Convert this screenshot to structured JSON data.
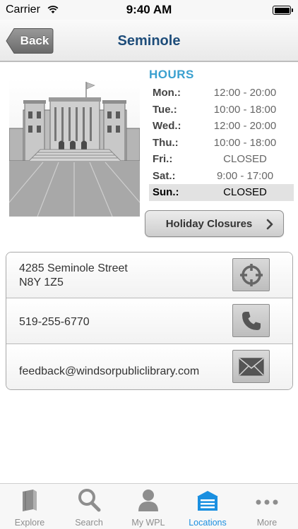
{
  "status_bar": {
    "carrier": "Carrier",
    "time": "9:40 AM"
  },
  "nav": {
    "back_label": "Back",
    "title": "Seminole"
  },
  "hours": {
    "title": "HOURS",
    "rows": [
      {
        "day": "Mon.:",
        "time": "12:00 - 20:00"
      },
      {
        "day": "Tue.:",
        "time": "10:00 - 18:00"
      },
      {
        "day": "Wed.:",
        "time": "12:00 - 20:00"
      },
      {
        "day": "Thu.:",
        "time": "10:00 - 18:00"
      },
      {
        "day": "Fri.:",
        "time": "CLOSED"
      },
      {
        "day": "Sat.:",
        "time": "9:00 - 17:00"
      },
      {
        "day": "Sun.:",
        "time": "CLOSED"
      }
    ]
  },
  "holiday_button": {
    "label": "Holiday Closures"
  },
  "contact": {
    "address_line1": "4285 Seminole Street",
    "address_line2": "N8Y 1Z5",
    "phone": "519-255-6770",
    "email": "feedback@windsorpubliclibrary.com"
  },
  "tabs": [
    {
      "label": "Explore",
      "icon": "book-icon"
    },
    {
      "label": "Search",
      "icon": "search-icon"
    },
    {
      "label": "My WPL",
      "icon": "person-icon"
    },
    {
      "label": "Locations",
      "icon": "library-building-icon"
    },
    {
      "label": "More",
      "icon": "more-dots-icon"
    }
  ],
  "colors": {
    "title": "#1e4d7a",
    "hours_heading": "#3aa0cf",
    "tab_active": "#1a8fe0"
  }
}
